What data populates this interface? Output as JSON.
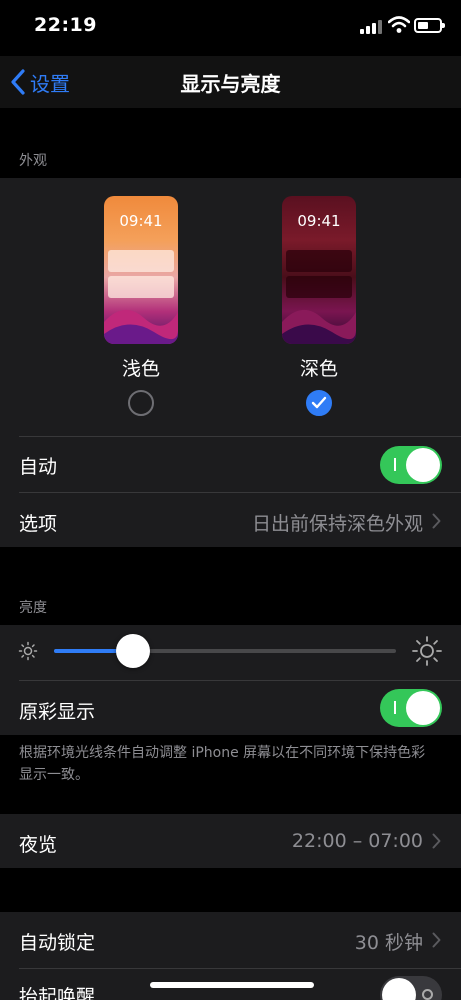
{
  "status": {
    "time": "22:19"
  },
  "nav": {
    "back_label": "设置",
    "title": "显示与亮度"
  },
  "appearance": {
    "section_label": "外观",
    "light": {
      "preview_time": "09:41",
      "label": "浅色",
      "selected": false
    },
    "dark": {
      "preview_time": "09:41",
      "label": "深色",
      "selected": true
    },
    "auto": {
      "label": "自动",
      "on": true
    },
    "options": {
      "label": "选项",
      "value": "日出前保持深色外观"
    }
  },
  "brightness": {
    "section_label": "亮度",
    "level": 0.23,
    "true_tone": {
      "label": "原彩显示",
      "on": true
    },
    "footnote": "根据环境光线条件自动调整 iPhone 屏幕以在不同环境下保持色彩显示一致。"
  },
  "night_shift": {
    "label": "夜览",
    "value": "22:00 – 07:00"
  },
  "auto_lock": {
    "label": "自动锁定",
    "value": "30 秒钟"
  },
  "raise_to_wake": {
    "label": "抬起唤醒",
    "on": false
  },
  "colors": {
    "accent": "#2f7cf6",
    "toggle_on": "#34c759",
    "background": "#000000",
    "cell": "#1c1c1e"
  }
}
